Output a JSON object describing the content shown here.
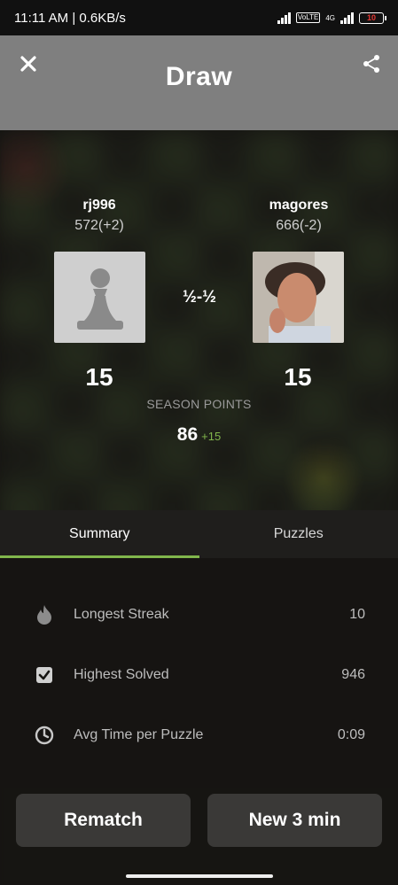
{
  "status_bar": {
    "time": "11:11 AM | 0.6KB/s",
    "network_tag": "VoLTE",
    "network_4g": "4G",
    "battery": "10"
  },
  "header": {
    "title": "Draw",
    "close_icon": "close-icon",
    "share_icon": "share-icon"
  },
  "players": {
    "left": {
      "name": "rj996",
      "rating": "572(+2)",
      "points": "15",
      "avatar": "pawn-avatar"
    },
    "right": {
      "name": "magores",
      "rating": "666(-2)",
      "points": "15",
      "avatar": "photo-avatar"
    }
  },
  "result": "½-½",
  "season": {
    "label": "SEASON POINTS",
    "value": "86",
    "delta": "+15"
  },
  "tabs": [
    {
      "label": "Summary",
      "active": true
    },
    {
      "label": "Puzzles",
      "active": false
    }
  ],
  "stats": [
    {
      "icon": "flame-icon",
      "label": "Longest Streak",
      "value": "10"
    },
    {
      "icon": "checkbox-icon",
      "label": "Highest Solved",
      "value": "946"
    },
    {
      "icon": "clock-icon",
      "label": "Avg Time per Puzzle",
      "value": "0:09"
    }
  ],
  "buttons": {
    "rematch": "Rematch",
    "new_game": "New 3 min"
  },
  "colors": {
    "accent": "#81b64c",
    "header_bg": "#7f7f7f",
    "button_bg": "#3a3937"
  }
}
